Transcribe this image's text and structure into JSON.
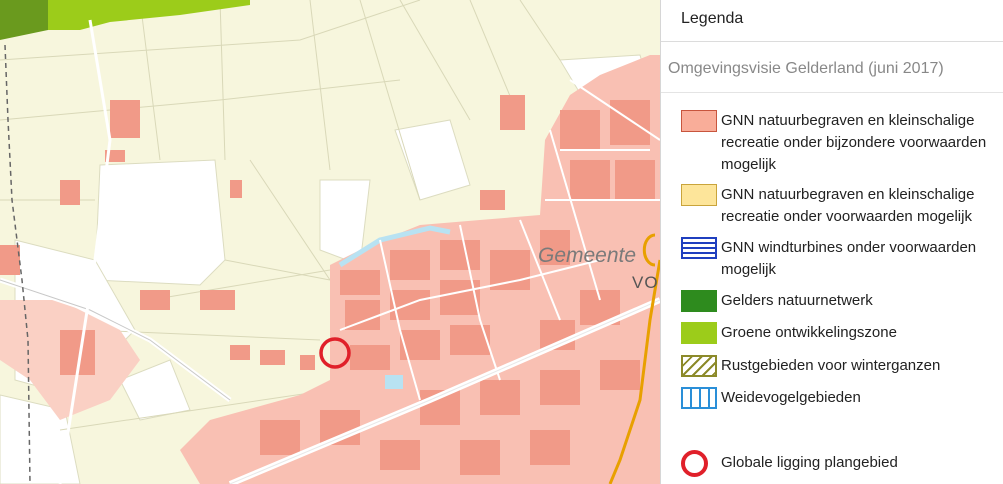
{
  "map": {
    "place_label": "Gemeente",
    "place_label_partial": "VO",
    "colors": {
      "background": "#f7f6dd",
      "built_area": "#f9c0b3",
      "buildings": "#f19a88",
      "fields_white": "#ffffff",
      "natuurnetwerk": "#2e8b1e",
      "ontwikkelingszone": "#9ccc1a",
      "water": "#b8e2f2",
      "marker": "#e0202a"
    }
  },
  "legend": {
    "title": "Legenda",
    "subtitle": "Omgevingsvisie Gelderland (juni 2017)",
    "items": [
      {
        "label": "GNN natuurbegraven en kleinschalige recreatie onder bijzondere voorwaarden mogelijk",
        "swatch": "pink-fill"
      },
      {
        "label": "GNN natuurbegraven en kleinschalige recreatie onder voorwaarden mogelijk",
        "swatch": "yellow-fill"
      },
      {
        "label": "GNN windturbines onder voorwaarden mogelijk",
        "swatch": "blue-horizontal-hatch"
      },
      {
        "label": "Gelders natuurnetwerk",
        "swatch": "dark-green-fill"
      },
      {
        "label": "Groene ontwikkelingszone",
        "swatch": "light-green-fill"
      },
      {
        "label": "Rustgebieden voor winterganzen",
        "swatch": "olive-diagonal-hatch"
      },
      {
        "label": "Weidevogelgebieden",
        "swatch": "cyan-vertical-hatch"
      },
      {
        "label": "Globale ligging plangebied",
        "swatch": "red-circle"
      }
    ]
  }
}
